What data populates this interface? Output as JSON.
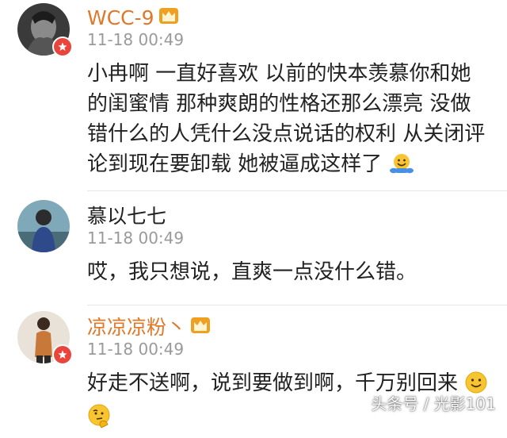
{
  "comments": [
    {
      "username": "WCC-9",
      "timestamp": "11-18 00:49",
      "text": "小冉啊 一直好喜欢 以前的快本羡慕你和她的闺蜜情 那种爽朗的性格还那么漂亮 没做错什么的人凭什么没点说话的权利 从关闭评论到现在要卸载 她被逼成这样了",
      "emoji": "hug-emoji",
      "has_crown": true,
      "verified_badge": true
    },
    {
      "username": "慕以七七",
      "timestamp": "11-18 00:49",
      "text": "哎，我只想说，直爽一点没什么错。",
      "has_crown": false,
      "verified_badge": false
    },
    {
      "username": "凉凉凉粉丶",
      "timestamp": "11-18 00:49",
      "text": "好走不送啊，说到要做到啊，千万别回来",
      "emoji_inline": "smile-emoji",
      "emoji_next_line": "thinking-emoji",
      "has_crown": true,
      "verified_badge": true
    }
  ],
  "watermark": "头条号 / 光影101",
  "colors": {
    "username_vip": "#e0782a",
    "username_plain": "#222222",
    "timestamp": "#9a9a9a",
    "badge": "#e8453c",
    "crown": "#f0a020"
  }
}
